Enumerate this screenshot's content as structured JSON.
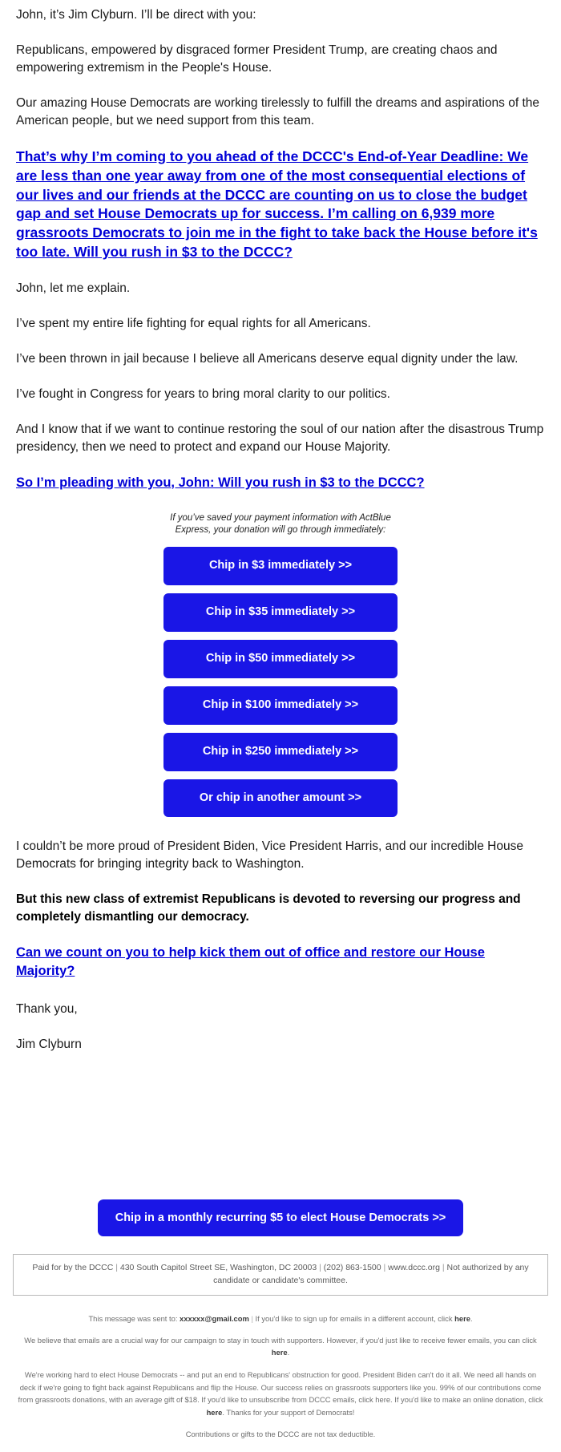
{
  "email": {
    "paragraphs": [
      "John, it’s Jim Clyburn. I’ll be direct with you:",
      "Republicans, empowered by disgraced former President Trump, are creating chaos and empowering extremism in the People's House.",
      "Our amazing House Democrats are working tirelessly to fulfill the dreams and aspirations of the American people, but we need support from this team."
    ],
    "main_link": "That’s why I’m coming to you ahead of the DCCC's End-of-Year Deadline: We are less than one year away from one of the most consequential elections of our lives and our friends at the DCCC are counting on us to close the budget gap and set House Democrats up for success. I’m calling on 6,939 more grassroots Democrats to join me in the fight to take back the House before it's too late. Will you rush in $3 to the DCCC?",
    "paragraphs2": [
      "John, let me explain.",
      "I’ve spent my entire life fighting for equal rights for all Americans.",
      "I’ve been thrown in jail because I believe all Americans deserve equal dignity under the law.",
      "I’ve fought in Congress for years to bring moral clarity to our politics.",
      "And I know that if we want to continue restoring the soul of our nation after the disastrous Trump presidency, then we need to protect and expand our House Majority."
    ],
    "pleading_link": "So I’m pleading with you, John: Will you rush in $3 to the DCCC?",
    "actblue_note": "If you’ve saved your payment information with ActBlue Express, your donation will go through immediately:",
    "donate_buttons": [
      "Chip in $3 immediately >>",
      "Chip in $35 immediately >>",
      "Chip in $50 immediately >>",
      "Chip in $100 immediately >>",
      "Chip in $250 immediately >>",
      "Or chip in another amount >>"
    ],
    "closing_paragraph": "I couldn’t be more proud of President Biden, Vice President Harris, and our incredible House Democrats for bringing integrity back to Washington.",
    "bold_paragraph": "But this new class of extremist Republicans is devoted to reversing our progress and completely dismantling our democracy.",
    "closing_link": "Can we count on you to help kick them out of office and restore our House Majority?",
    "signoff": "Thank you,",
    "signature": "Jim Clyburn",
    "monthly_button": "Chip in a monthly recurring $5 to elect House Democrats >>"
  },
  "footer": {
    "disclaimer_parts": [
      "Paid for by the DCCC",
      "430 South Capitol Street SE, Washington, DC 20003",
      "(202) 863-1500",
      "www.dccc.org",
      "Not authorized by any candidate or candidate's committee."
    ],
    "sent_to_prefix": "This message was sent to:",
    "sent_to_email": "xxxxxx@gmail.com",
    "sent_to_suffix": "If you'd like to sign up for emails in a different account, click",
    "here": "here",
    "fewer_emails_text": "We believe that emails are a crucial way for our campaign to stay in touch with supporters. However, if you'd just like to receive fewer emails, you can click",
    "long_block_1": "We're working hard to elect House Democrats -- and put an end to Republicans' obstruction for good. President Biden can't do it all. We need all hands on deck if we're going to fight back against Republicans and flip the House. Our success relies on grassroots supporters like you. 99% of our contributions come from grassroots donations, with an average gift of $18. If you'd like to unsubscribe from DCCC emails, click here. If you'd like to make an online donation, click",
    "long_block_2": ". Thanks for your support of Democrats!",
    "tax_note": "Contributions or gifts to the DCCC are not tax deductible."
  },
  "colors": {
    "link_blue": "#0000d6",
    "button_blue": "#1a16e6",
    "text": "#1a1a1a",
    "footer_gray": "#6e6e6e"
  }
}
